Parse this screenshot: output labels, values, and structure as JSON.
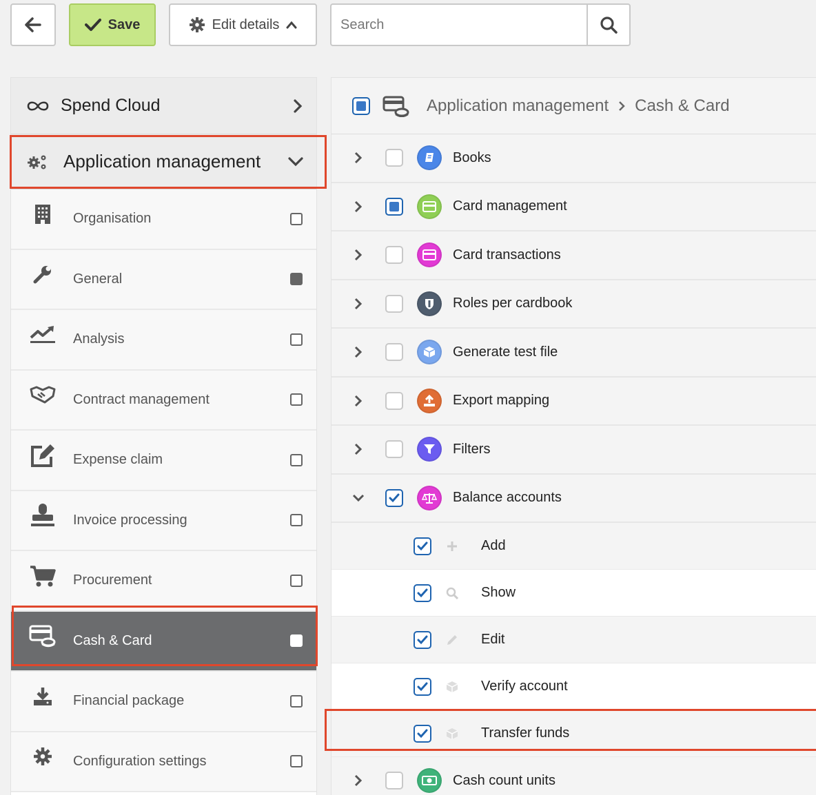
{
  "toolbar": {
    "save_label": "Save",
    "edit_label": "Edit details",
    "search_placeholder": "Search"
  },
  "sidebar": {
    "top": "Spend Cloud",
    "section": "Application management",
    "items": [
      {
        "label": "Organisation",
        "icon": "building-icon",
        "state": "empty"
      },
      {
        "label": "General",
        "icon": "wrench-icon",
        "state": "filled"
      },
      {
        "label": "Analysis",
        "icon": "chart-line-icon",
        "state": "empty"
      },
      {
        "label": "Contract management",
        "icon": "handshake-icon",
        "state": "empty"
      },
      {
        "label": "Expense claim",
        "icon": "edit-icon",
        "state": "empty"
      },
      {
        "label": "Invoice processing",
        "icon": "stamp-icon",
        "state": "empty"
      },
      {
        "label": "Procurement",
        "icon": "cart-icon",
        "state": "empty"
      },
      {
        "label": "Cash & Card",
        "icon": "cash-card-icon",
        "state": "active"
      },
      {
        "label": "Financial package",
        "icon": "download-icon",
        "state": "empty"
      },
      {
        "label": "Configuration settings",
        "icon": "cog-icon",
        "state": "empty"
      }
    ]
  },
  "main": {
    "breadcrumb": [
      "Application management",
      "Cash & Card"
    ],
    "rows": [
      {
        "label": "Books",
        "color": "#4a86e8",
        "icon": "book-icon",
        "state": "empty"
      },
      {
        "label": "Card management",
        "color": "#8fcf55",
        "icon": "card-icon",
        "state": "partial"
      },
      {
        "label": "Card transactions",
        "color": "#e23ad4",
        "icon": "card-icon",
        "state": "empty"
      },
      {
        "label": "Roles per cardbook",
        "color": "#4f5d6e",
        "icon": "shield-icon",
        "state": "empty"
      },
      {
        "label": "Generate test file",
        "color": "#7aa7ee",
        "icon": "cube-icon",
        "state": "empty"
      },
      {
        "label": "Export mapping",
        "color": "#e06d35",
        "icon": "upload-icon",
        "state": "empty"
      },
      {
        "label": "Filters",
        "color": "#6b5cf0",
        "icon": "filter-icon",
        "state": "empty"
      },
      {
        "label": "Balance accounts",
        "color": "#e23ad4",
        "icon": "balance-icon",
        "state": "checked"
      }
    ],
    "subrows": [
      {
        "label": "Add",
        "icon": "plus-icon"
      },
      {
        "label": "Show",
        "icon": "search-icon"
      },
      {
        "label": "Edit",
        "icon": "pencil-icon"
      },
      {
        "label": "Verify account",
        "icon": "cube-icon"
      },
      {
        "label": "Transfer funds",
        "icon": "cube-icon"
      }
    ],
    "last_row": {
      "label": "Cash count units",
      "color": "#3fb37a",
      "icon": "money-icon",
      "state": "empty"
    }
  }
}
